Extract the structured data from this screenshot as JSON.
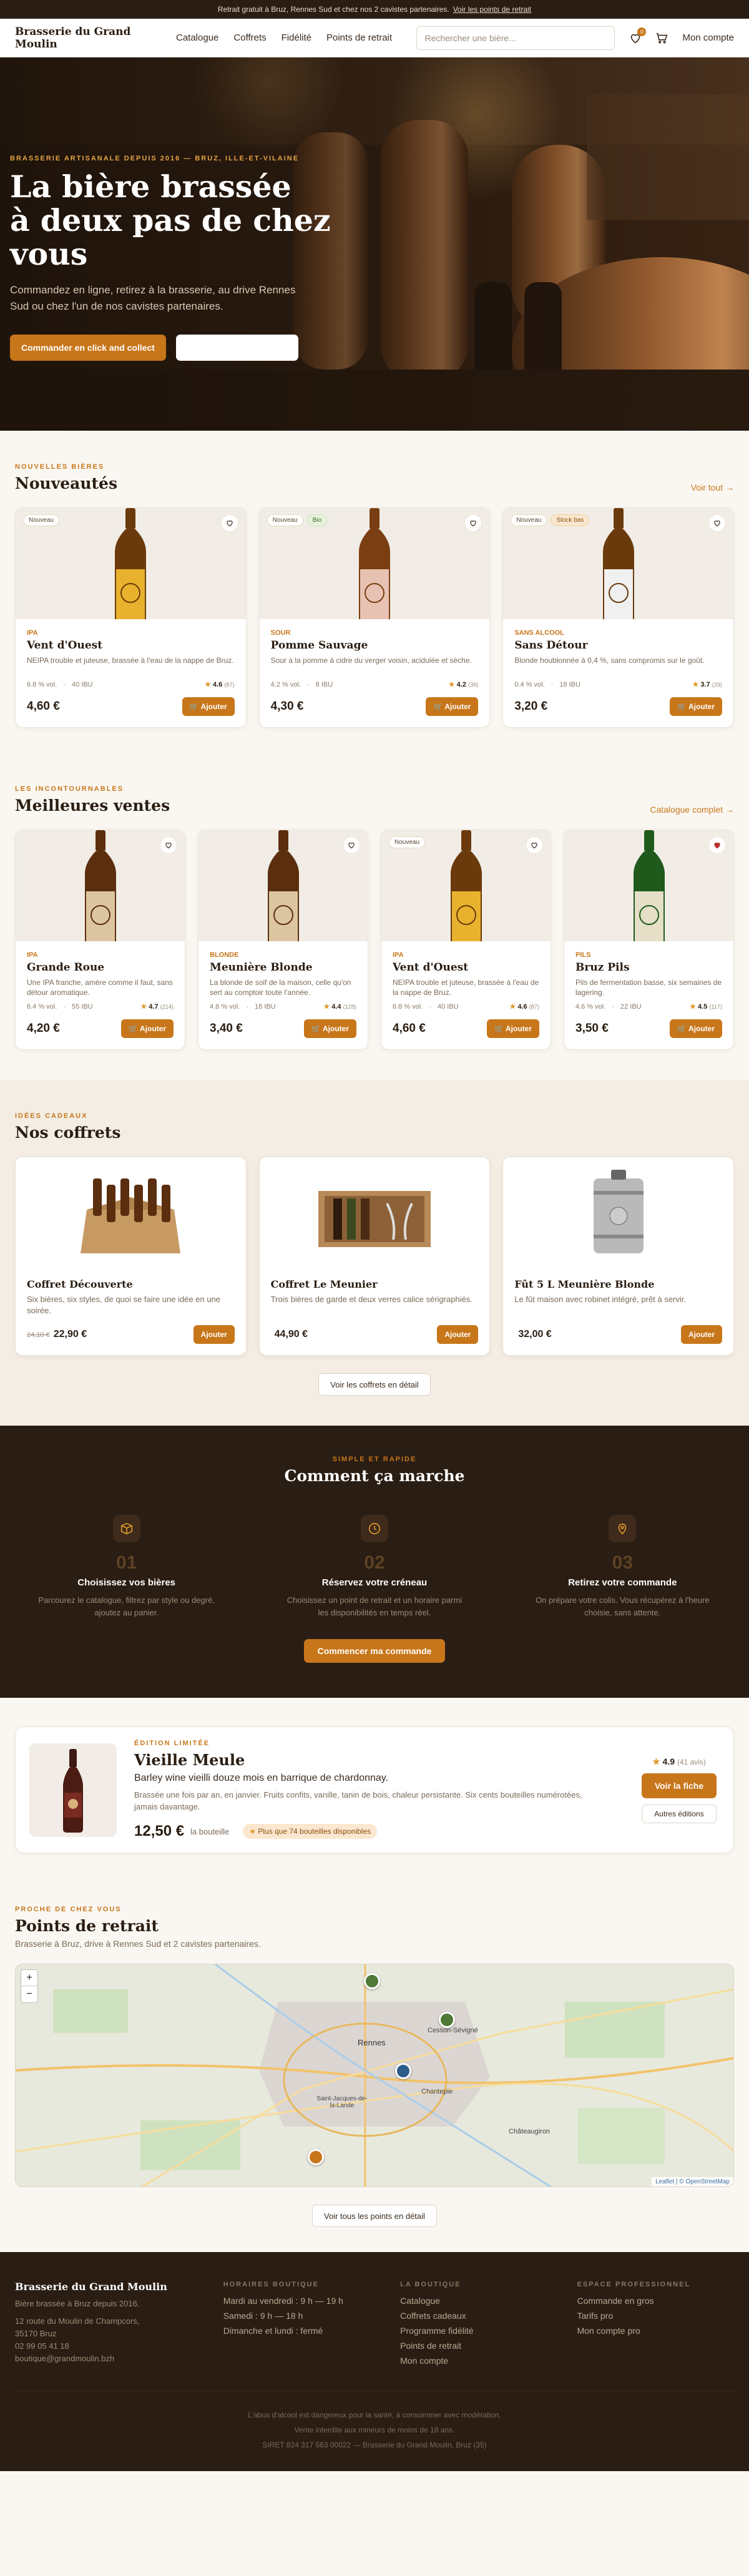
{
  "promo": {
    "text": "Retrait gratuit à Bruz, Rennes Sud et chez nos 2 cavistes partenaires.",
    "link": "Voir les points de retrait"
  },
  "header": {
    "logo": "Brasserie du Grand Moulin",
    "nav": [
      "Catalogue",
      "Coffrets",
      "Fidélité",
      "Points de retrait"
    ],
    "search_placeholder": "Rechercher une bière...",
    "favorites_count": "0",
    "account": "Mon compte"
  },
  "hero": {
    "kicker": "Brasserie artisanale depuis 2016 — Bruz, Ille-et-Vilaine",
    "title_line1": "La bière brassée",
    "title_line2": "à deux pas de chez vous",
    "text": "Commandez en ligne, retirez à la brasserie, au drive Rennes Sud ou chez l'un de nos cavistes partenaires.",
    "cta_primary": "Commander en click and collect"
  },
  "nouveautes": {
    "kicker": "Nouvelles bières",
    "title": "Nouveautés",
    "link": "Voir tout →",
    "items": [
      {
        "tags": [
          "Nouveau"
        ],
        "style": "IPA",
        "name": "Vent d'Ouest",
        "desc": "NEIPA trouble et juteuse, brassée à l'eau de la nappe de Bruz.",
        "abv": "6.8 % vol.",
        "ibu": "40 IBU",
        "rating": "4.6",
        "reviews": "(87)",
        "price": "4,60 €",
        "add": "Ajouter"
      },
      {
        "tags": [
          "Nouveau",
          "Bio"
        ],
        "style": "Sour",
        "name": "Pomme Sauvage",
        "desc": "Sour à la pomme à cidre du verger voisin, acidulée et sèche.",
        "abv": "4.2 % vol.",
        "ibu": "8 IBU",
        "rating": "4.2",
        "reviews": "(39)",
        "price": "4,30 €",
        "add": "Ajouter"
      },
      {
        "tags": [
          "Nouveau",
          "Stock bas"
        ],
        "style": "Sans alcool",
        "name": "Sans Détour",
        "desc": "Blonde houblonnée à 0,4 %, sans compromis sur le goût.",
        "abv": "0.4 % vol.",
        "ibu": "18 IBU",
        "rating": "3.7",
        "reviews": "(29)",
        "price": "3,20 €",
        "add": "Ajouter"
      }
    ]
  },
  "meilleures": {
    "kicker": "Les incontournables",
    "title": "Meilleures ventes",
    "link": "Catalogue complet →",
    "items": [
      {
        "tags": [],
        "style": "IPA",
        "name": "Grande Roue",
        "desc": "Une IPA franche, amère comme il faut, sans détour aromatique.",
        "abv": "6.4 % vol.",
        "ibu": "55 IBU",
        "rating": "4.7",
        "reviews": "(214)",
        "price": "4,20 €",
        "add": "Ajouter"
      },
      {
        "tags": [],
        "style": "Blonde",
        "name": "Meunière Blonde",
        "desc": "La blonde de soif de la maison, celle qu'on sert au comptoir toute l'année.",
        "abv": "4.8 % vol.",
        "ibu": "18 IBU",
        "rating": "4.4",
        "reviews": "(128)",
        "price": "3,40 €",
        "add": "Ajouter"
      },
      {
        "tags": [
          "Nouveau"
        ],
        "style": "IPA",
        "name": "Vent d'Ouest",
        "desc": "NEIPA trouble et juteuse, brassée à l'eau de la nappe de Bruz.",
        "abv": "6.8 % vol.",
        "ibu": "40 IBU",
        "rating": "4.6",
        "reviews": "(87)",
        "price": "4,60 €",
        "add": "Ajouter"
      },
      {
        "tags": [],
        "style": "Pils",
        "name": "Bruz Pils",
        "desc": "Pils de fermentation basse, six semaines de lagering.",
        "abv": "4.6 % vol.",
        "ibu": "22 IBU",
        "rating": "4.5",
        "reviews": "(117)",
        "price": "3,50 €",
        "add": "Ajouter"
      }
    ]
  },
  "coffrets": {
    "kicker": "Idées cadeaux",
    "title": "Nos coffrets",
    "items": [
      {
        "name": "Coffret Découverte",
        "desc": "Six bières, six styles, de quoi se faire une idée en une soirée.",
        "old": "24,10 €",
        "price": "22,90 €",
        "add": "Ajouter"
      },
      {
        "name": "Coffret Le Meunier",
        "desc": "Trois bières de garde et deux verres calice sérigraphiés.",
        "old": "",
        "price": "44,90 €",
        "add": "Ajouter"
      },
      {
        "name": "Fût 5 L Meunière Blonde",
        "desc": "Le fût maison avec robinet intégré, prêt à servir.",
        "old": "",
        "price": "32,00 €",
        "add": "Ajouter"
      }
    ],
    "more": "Voir les coffrets en détail"
  },
  "how": {
    "kicker": "Simple et rapide",
    "title": "Comment ça marche",
    "steps": [
      {
        "num": "01",
        "title": "Choisissez vos bières",
        "desc": "Parcourez le catalogue, filtrez par style ou degré, ajoutez au panier."
      },
      {
        "num": "02",
        "title": "Réservez votre créneau",
        "desc": "Choisissez un point de retrait et un horaire parmi les disponibilités en temps réel."
      },
      {
        "num": "03",
        "title": "Retirez votre commande",
        "desc": "On prépare votre colis. Vous récupérez à l'heure choisie, sans attente."
      }
    ],
    "cta": "Commencer ma commande"
  },
  "featured": {
    "kicker": "Édition limitée",
    "title": "Vieille Meule",
    "subtitle": "Barley wine vieilli douze mois en barrique de chardonnay.",
    "desc": "Brassée une fois par an, en janvier. Fruits confits, vanille, tanin de bois, chaleur persistante. Six cents bouteilles numérotées, jamais davantage.",
    "price": "12,50 €",
    "unit": "la bouteille",
    "stock": "Plus que 74 bouteilles disponibles",
    "rating": "4.9",
    "reviews": "(41 avis)",
    "cta": "Voir la fiche",
    "other": "Autres éditions"
  },
  "points": {
    "kicker": "Proche de chez vous",
    "title": "Points de retrait",
    "subtitle": "Brasserie à Bruz, drive à Rennes Sud et 2 cavistes partenaires.",
    "map_labels": {
      "city": "Rennes",
      "chantepie": "Chantepie",
      "cesson": "Cesson-Sévigné",
      "chateaugiron": "Châteaugiron",
      "saint_jacques": "Saint-Jacques-de-la-Lande",
      "attribution": "Leaflet | © OpenStreetMap"
    },
    "more": "Voir tous les points en détail"
  },
  "footer": {
    "brand": "Brasserie du Grand Moulin",
    "tagline": "Bière brassée à Bruz depuis 2016.",
    "address": [
      "12 route du Moulin de Champcors,",
      "35170 Bruz",
      "02 99 05 41 18",
      "boutique@grandmoulin.bzh"
    ],
    "hours_title": "Horaires boutique",
    "hours": [
      "Mardi au vendredi : 9 h — 19 h",
      "Samedi : 9 h — 18 h",
      "Dimanche et lundi : fermé"
    ],
    "shop_title": "La boutique",
    "shop": [
      "Catalogue",
      "Coffrets cadeaux",
      "Programme fidélité",
      "Points de retrait",
      "Mon compte"
    ],
    "pro_title": "Espace professionnel",
    "pro": [
      "Commande en gros",
      "Tarifs pro",
      "Mon compte pro"
    ],
    "legal": [
      "L'abus d'alcool est dangereux pour la santé, à consommer avec modération.",
      "Vente interdite aux mineurs de moins de 18 ans.",
      "SIRET 824 317 563 00022 — Brasserie du Grand Moulin, Bruz (35)"
    ]
  },
  "colors": {
    "accent": "#c8761a",
    "dark": "#2a1d13",
    "cream": "#faf7f2"
  }
}
